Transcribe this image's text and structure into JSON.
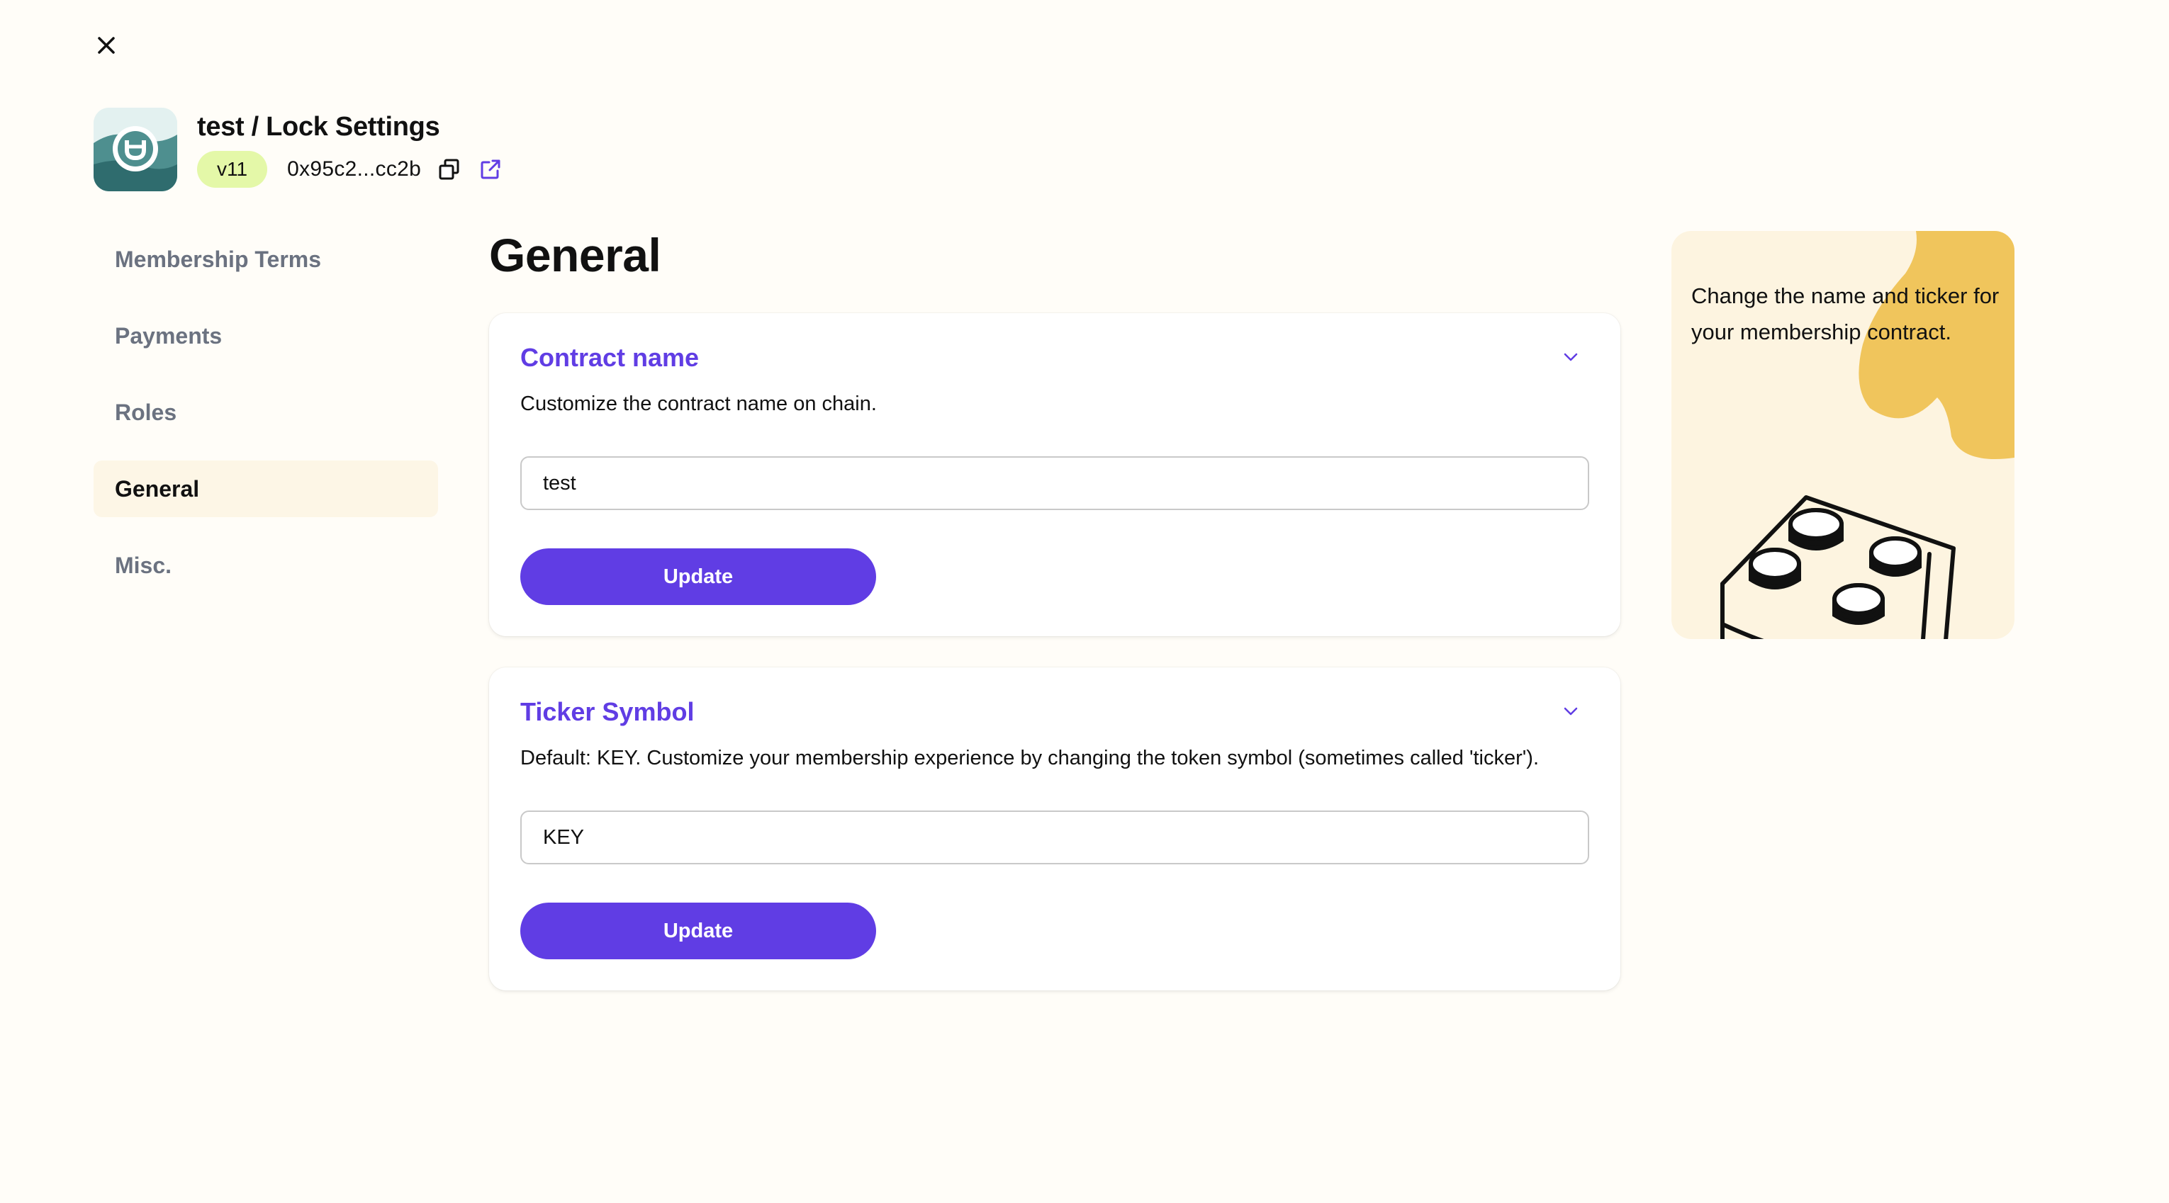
{
  "header": {
    "title": "test / Lock Settings",
    "version": "v11",
    "address": "0x95c2...cc2b"
  },
  "sidebar": {
    "items": [
      {
        "label": "Membership Terms",
        "active": false
      },
      {
        "label": "Payments",
        "active": false
      },
      {
        "label": "Roles",
        "active": false
      },
      {
        "label": "General",
        "active": true
      },
      {
        "label": "Misc.",
        "active": false
      }
    ]
  },
  "main": {
    "title": "General",
    "cards": [
      {
        "title": "Contract name",
        "description": "Customize the contract name on chain.",
        "input_value": "test",
        "button_label": "Update"
      },
      {
        "title": "Ticker Symbol",
        "description": "Default: KEY. Customize your membership experience by changing the token symbol (sometimes called 'ticker').",
        "input_value": "KEY",
        "button_label": "Update"
      }
    ]
  },
  "help": {
    "text": "Change the name and ticker for your membership contract."
  },
  "colors": {
    "accent": "#603de4",
    "background": "#fffdf8",
    "badge": "#e4f8a8",
    "sidebar_active": "#fdf6e6",
    "help_panel": "#fdf4e0",
    "help_shape": "#f0c55c"
  },
  "icons": {
    "close": "close-icon",
    "copy": "copy-icon",
    "external": "external-link-icon",
    "chevron": "chevron-down-icon"
  }
}
